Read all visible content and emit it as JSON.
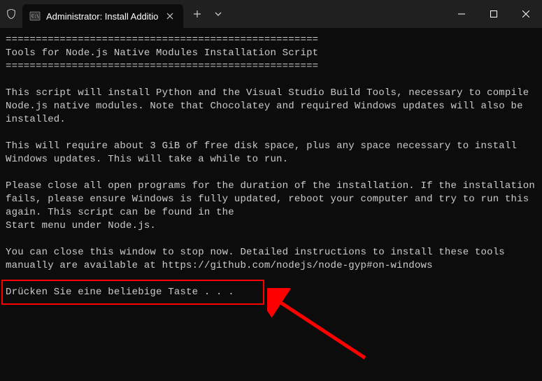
{
  "titlebar": {
    "tab_title": "Administrator:  Install Additio",
    "close_tab": "✕",
    "new_tab": "+",
    "dropdown": "⌄"
  },
  "terminal": {
    "line1": "====================================================",
    "line2": "Tools for Node.js Native Modules Installation Script",
    "line3": "====================================================",
    "para1": "This script will install Python and the Visual Studio Build Tools, necessary to compile Node.js native modules. Note that Chocolatey and required Windows updates will also be installed.",
    "para2": "This will require about 3 GiB of free disk space, plus any space necessary to install Windows updates. This will take a while to run.",
    "para3": "Please close all open programs for the duration of the installation. If the installation fails, please ensure Windows is fully updated, reboot your computer and try to run this again. This script can be found in the\nStart menu under Node.js.",
    "para4": "You can close this window to stop now. Detailed instructions to install these tools manually are available at https://github.com/nodejs/node-gyp#on-windows",
    "prompt": "Drücken Sie eine beliebige Taste . . ."
  }
}
